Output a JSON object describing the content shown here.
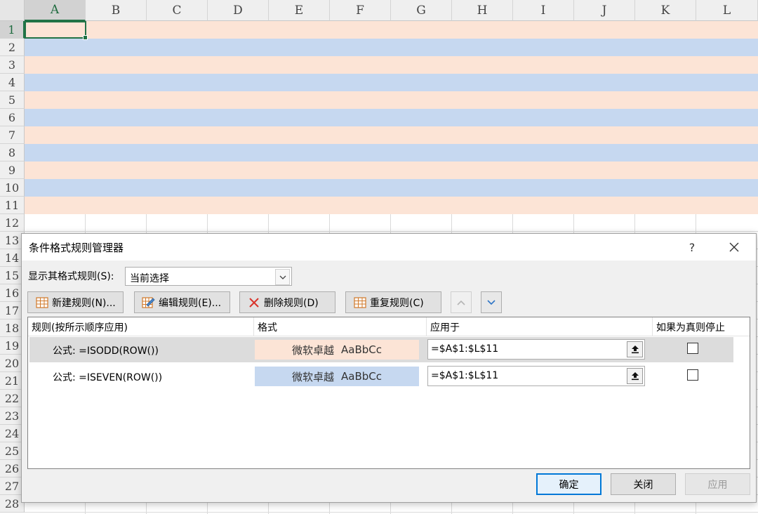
{
  "spreadsheet": {
    "columns": [
      "A",
      "B",
      "C",
      "D",
      "E",
      "F",
      "G",
      "H",
      "I",
      "J",
      "K",
      "L"
    ],
    "rows": [
      "1",
      "2",
      "3",
      "4",
      "5",
      "6",
      "7",
      "8",
      "9",
      "10",
      "11",
      "12",
      "13",
      "14",
      "15",
      "16",
      "17",
      "18",
      "19",
      "20",
      "21",
      "22",
      "23",
      "24",
      "25",
      "26",
      "27",
      "28"
    ],
    "active_cell": "A1",
    "band_colors": {
      "odd": "#fce4d6",
      "even": "#c6d8f0"
    }
  },
  "dialog": {
    "title": "条件格式规则管理器",
    "help": "?",
    "show_rules_label": "显示其格式规则(S):",
    "show_rules_value": "当前选择",
    "toolbar": {
      "new_rule": "新建规则(N)...",
      "edit_rule": "编辑规则(E)...",
      "delete_rule": "删除规则(D)",
      "duplicate_rule": "重复规则(C)"
    },
    "columns": {
      "rule": "规则(按所示顺序应用)",
      "format": "格式",
      "applies_to": "应用于",
      "stop_if_true": "如果为真则停止"
    },
    "rules": [
      {
        "name": "公式: =ISODD(ROW())",
        "preview_cn": "微软卓越",
        "preview_en": "AaBbCc",
        "applies_to": "=$A$1:$L$11",
        "stop": false
      },
      {
        "name": "公式: =ISEVEN(ROW())",
        "preview_cn": "微软卓越",
        "preview_en": "AaBbCc",
        "applies_to": "=$A$1:$L$11",
        "stop": false
      }
    ],
    "buttons": {
      "ok": "确定",
      "close": "关闭",
      "apply": "应用"
    }
  }
}
